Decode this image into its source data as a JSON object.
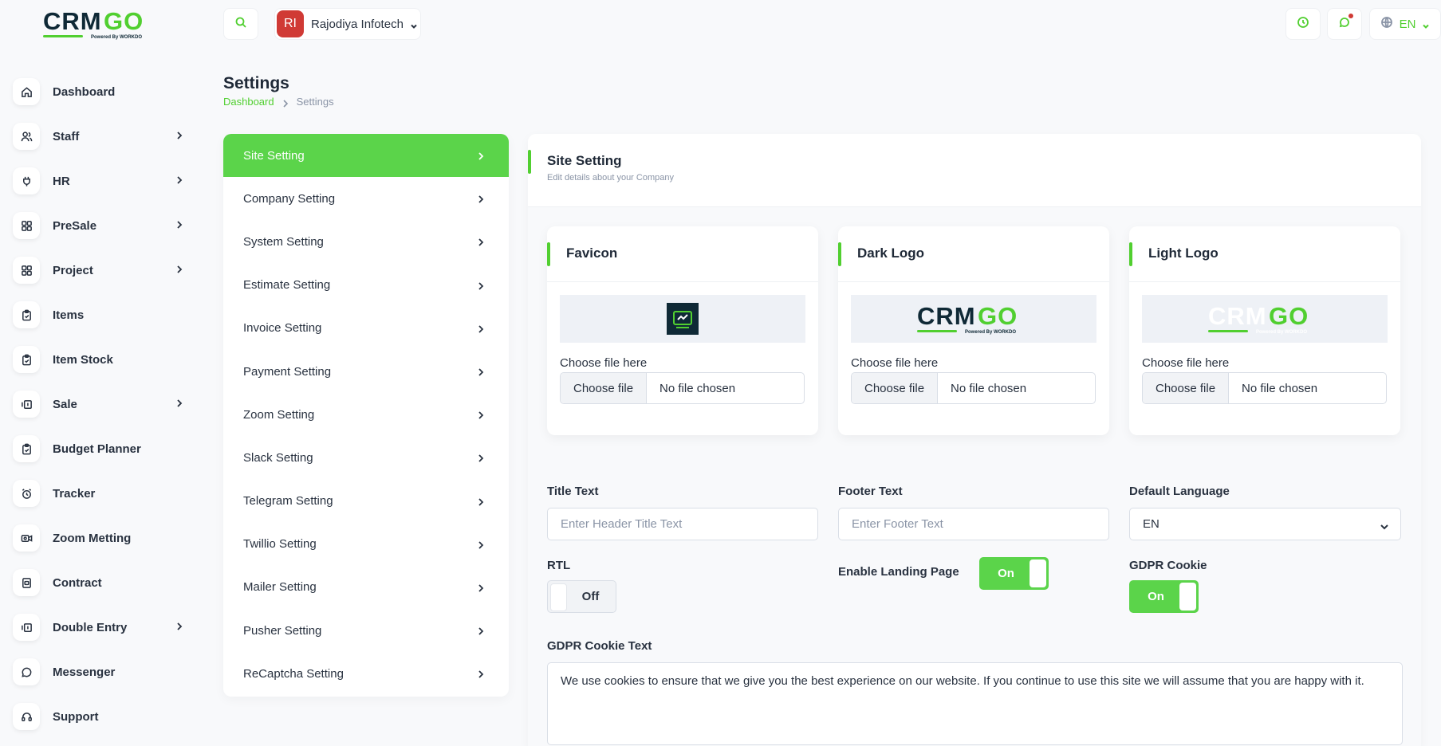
{
  "brand": {
    "logo_text_dark": "CRM",
    "logo_text_green": "GO",
    "logo_tagline": "Powered By WORKDO"
  },
  "sidebar": {
    "items": [
      {
        "label": "Dashboard",
        "icon": "home-icon",
        "has_arrow": false
      },
      {
        "label": "Staff",
        "icon": "users-icon",
        "has_arrow": true
      },
      {
        "label": "HR",
        "icon": "plug-icon",
        "has_arrow": true
      },
      {
        "label": "PreSale",
        "icon": "grid-icon",
        "has_arrow": true
      },
      {
        "label": "Project",
        "icon": "grid-icon",
        "has_arrow": true
      },
      {
        "label": "Items",
        "icon": "clipboard-icon",
        "has_arrow": false
      },
      {
        "label": "Item Stock",
        "icon": "clipboard-icon",
        "has_arrow": false
      },
      {
        "label": "Sale",
        "icon": "cash-icon",
        "has_arrow": true
      },
      {
        "label": "Budget Planner",
        "icon": "clipboard-icon",
        "has_arrow": false
      },
      {
        "label": "Tracker",
        "icon": "alarm-icon",
        "has_arrow": false
      },
      {
        "label": "Zoom Metting",
        "icon": "video-icon",
        "has_arrow": false
      },
      {
        "label": "Contract",
        "icon": "device-icon",
        "has_arrow": false
      },
      {
        "label": "Double Entry",
        "icon": "cash-icon",
        "has_arrow": true
      },
      {
        "label": "Messenger",
        "icon": "chat-icon",
        "has_arrow": false
      },
      {
        "label": "Support",
        "icon": "headset-icon",
        "has_arrow": false
      }
    ]
  },
  "header": {
    "avatar_initials": "RI",
    "company_name": "Rajodiya Infotech",
    "language": "EN"
  },
  "page": {
    "title": "Settings",
    "breadcrumb": {
      "home": "Dashboard",
      "current": "Settings"
    }
  },
  "settings_menu": [
    "Site Setting",
    "Company Setting",
    "System Setting",
    "Estimate Setting",
    "Invoice Setting",
    "Payment Setting",
    "Zoom Setting",
    "Slack Setting",
    "Telegram Setting",
    "Twillio Setting",
    "Mailer Setting",
    "Pusher Setting",
    "ReCaptcha Setting"
  ],
  "site_setting": {
    "title": "Site Setting",
    "subtitle": "Edit details about your Company",
    "logo_cards": [
      {
        "title": "Favicon",
        "file_label": "Choose file here",
        "button": "Choose file",
        "status": "No file chosen"
      },
      {
        "title": "Dark Logo",
        "file_label": "Choose file here",
        "button": "Choose file",
        "status": "No file chosen"
      },
      {
        "title": "Light Logo",
        "file_label": "Choose file here",
        "button": "Choose file",
        "status": "No file chosen"
      }
    ],
    "title_text": {
      "label": "Title Text",
      "placeholder": "Enter Header Title Text"
    },
    "footer_text": {
      "label": "Footer Text",
      "placeholder": "Enter Footer Text"
    },
    "default_language": {
      "label": "Default Language",
      "value": "EN"
    },
    "rtl": {
      "label": "RTL",
      "state": "Off"
    },
    "landing_page": {
      "label": "Enable Landing Page",
      "state": "On"
    },
    "gdpr_cookie": {
      "label": "GDPR Cookie",
      "state": "On"
    },
    "gdpr_text": {
      "label": "GDPR Cookie Text",
      "value": "We use cookies to ensure that we give you the best experience on our website. If you continue to use this site we will assume that you are happy with it."
    }
  },
  "colors": {
    "accent": "#51cf30",
    "active_menu": "#5bd44a",
    "avatar": "#d03a35",
    "dark_text": "#293240"
  }
}
